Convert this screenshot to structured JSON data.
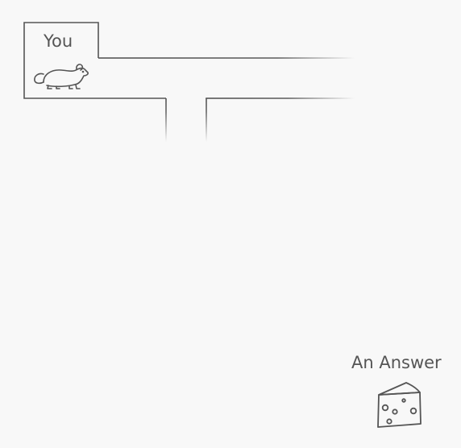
{
  "start": {
    "label": "You",
    "icon": "mouse-icon"
  },
  "goal": {
    "label": "An Answer",
    "icon": "cheese-icon"
  },
  "colors": {
    "background": "#f8f8f8",
    "wall": "#555555",
    "text": "#555555"
  }
}
